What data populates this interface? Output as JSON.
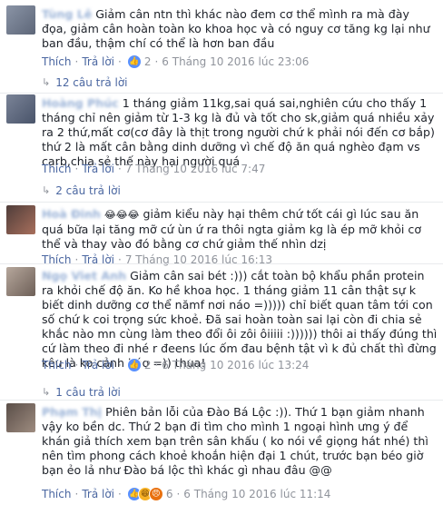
{
  "actions": {
    "like": "Thích",
    "reply": "Trả lời"
  },
  "comments": [
    {
      "author": "Tùng Lê",
      "text": "Giảm cân ntn thì khác nào đem cơ thể mình ra mà đày đọa, giảm cân hoàn toàn ko khoa học và có nguy cơ tăng kg lại như ban đầu, thậm chí có thể là hơn ban đầu",
      "reaction_count": "2",
      "timestamp": "6 Tháng 10 2016 lúc 23:06",
      "replies_label": "12 câu trả lời"
    },
    {
      "author": "Hoàng Phúc",
      "text": "1 tháng giảm 11kg,sai quá sai,nghiên cứu cho thấy 1 tháng chỉ nên giảm từ 1-3 kg là đủ và tốt cho sk,giảm quá nhiều xảy ra 2 thứ,mất cơ(cơ đây là thịt trong người chứ k phải nói đến cơ bắp) thứ 2 là mất cân bằng dinh dưỡng vì chế độ ăn quá nghèo đạm vs carb,chia sẻ thế này hại người quá",
      "timestamp": "7 Tháng 10 2016 lúc 7:47",
      "replies_label": "2 câu trả lời"
    },
    {
      "author": "Hoà Đinh",
      "emoji_prefix": "😂😂😂",
      "text": "giảm kiểu này hại thêm chứ tốt cái gì lúc sau ăn quá bữa lại tăng mỡ cứ ùn ứ ra thôi ngta giảm kg là ép mỡ khỏi cơ thể và thay vào đó bằng cơ chứ giảm thế nhìn dzị",
      "timestamp": "7 Tháng 10 2016 lúc 16:13"
    },
    {
      "author": "Ngọ Viet Anh",
      "text": "Giảm cân sai bét :))) cắt toàn bộ khẩu phần protein ra khỏi chế độ ăn. Ko hề khoa học. 1 tháng giảm 11 cân thật sự k biết dinh dưỡng cơ thể nămf nơi náo =))))) chỉ biết quan tâm tới con số chứ k coi trọng sức khoẻ. Đã sai hoàn toàn sai lại còn đi chia sẻ khắc nào mn cùng làm theo đổi ôi zôi ôiiiii :)))))) thôi ai thấy đúng thì cứ làm theo đi nhé r đeens lúc ốm đau bệnh tật vì k đủ chất thì đừng kêu là ko cảnh báo =)) thua!",
      "reaction_count": "2",
      "timestamp": "6 Tháng 10 2016 lúc 13:24",
      "replies_label": "1 câu trả lời"
    },
    {
      "author": "Phạm Thị",
      "text": "Phiên bản lỗi của Đào Bá Lộc :)). Thứ 1 bạn giảm nhanh vậy ko bền dc. Thứ 2 bạn đi tìm cho mình 1 ngoại hình ưng ý để khán giả thích xem bạn trên sân khấu ( ko nói về giọng hát nhé) thì nên tìm phong cách khoẻ khoắn hiện đại 1 chút, trước bạn béo giờ bạn ẻo lả như Đào bá lộc thì khác gì nhau đâu @@",
      "reaction_count": "6",
      "timestamp": "6 Tháng 10 2016 lúc 11:14"
    }
  ]
}
